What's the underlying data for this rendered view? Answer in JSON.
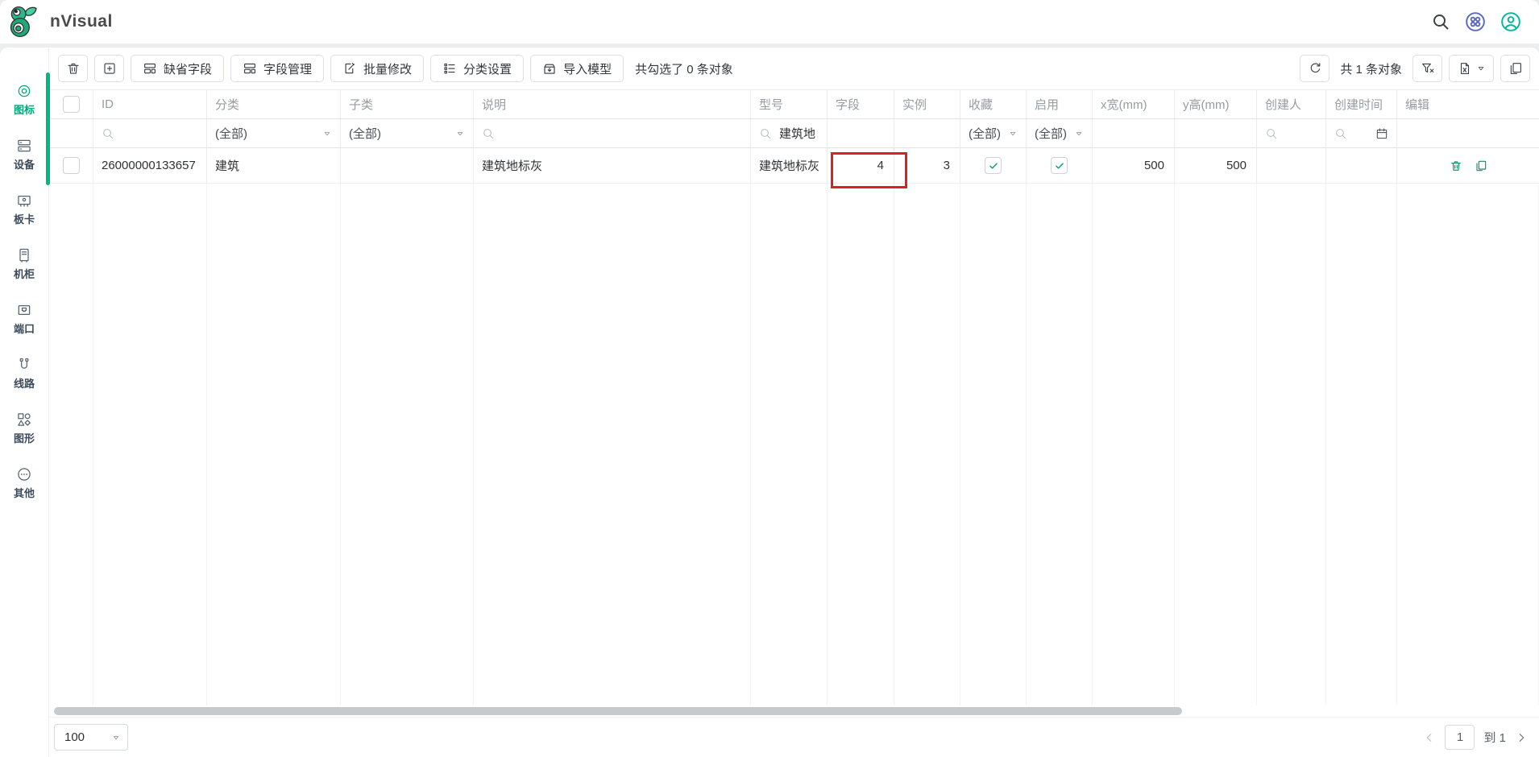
{
  "brand": {
    "name": "nVisual",
    "logo_icon": "bird-logo-icon"
  },
  "topbar": {
    "icons": [
      "search-icon",
      "apps-icon",
      "user-icon"
    ]
  },
  "sidebar": {
    "items": [
      {
        "label": "图标",
        "icon": "target-icon",
        "active": true
      },
      {
        "label": "设备",
        "icon": "server-icon",
        "active": false
      },
      {
        "label": "板卡",
        "icon": "board-icon",
        "active": false
      },
      {
        "label": "机柜",
        "icon": "cabinet-icon",
        "active": false
      },
      {
        "label": "端口",
        "icon": "port-icon",
        "active": false
      },
      {
        "label": "线路",
        "icon": "cable-icon",
        "active": false
      },
      {
        "label": "图形",
        "icon": "shapes-icon",
        "active": false
      },
      {
        "label": "其他",
        "icon": "more-circle-icon",
        "active": false
      }
    ]
  },
  "toolbar": {
    "icon_buttons": [
      {
        "name": "delete",
        "icon": "trash-icon"
      },
      {
        "name": "add",
        "icon": "plus-square-icon"
      }
    ],
    "buttons": [
      {
        "label": "缺省字段",
        "icon": "fields-icon"
      },
      {
        "label": "字段管理",
        "icon": "fields-icon"
      },
      {
        "label": "批量修改",
        "icon": "batch-edit-icon"
      },
      {
        "label": "分类设置",
        "icon": "category-list-icon"
      },
      {
        "label": "导入模型",
        "icon": "import-model-icon"
      }
    ],
    "selection_text": "共勾选了 0 条对象",
    "right": {
      "refresh_icon": "refresh-icon",
      "count_text": "共 1 条对象",
      "filter_clear_icon": "filter-clear-icon",
      "export_icon": "excel-export-icon",
      "columns_icon": "columns-icon"
    }
  },
  "table": {
    "columns": [
      "ID",
      "分类",
      "子类",
      "说明",
      "型号",
      "字段",
      "实例",
      "收藏",
      "启用",
      "x宽(mm)",
      "y高(mm)",
      "创建人",
      "创建时间",
      "编辑"
    ],
    "filters": {
      "category": "(全部)",
      "subclass": "(全部)",
      "model_query": "建筑地",
      "favorite": "(全部)",
      "enabled": "(全部)"
    },
    "rows": [
      {
        "id": "26000000133657",
        "category": "建筑",
        "subclass": "",
        "description": "建筑地标灰",
        "model": "建筑地标灰",
        "fields": "4",
        "instances": "3",
        "favorite": true,
        "enabled": true,
        "x_width_mm": "500",
        "y_height_mm": "500",
        "creator": "",
        "created_time": ""
      }
    ]
  },
  "pagination": {
    "page_size": "100",
    "current_page": "1",
    "total_pages_text": "到 1"
  },
  "colors": {
    "accent": "#00A87B",
    "highlight_box": "#E02020",
    "check": "#0C9B72",
    "apps_icon": "#5B68C2",
    "user_icon": "#00B89C"
  }
}
